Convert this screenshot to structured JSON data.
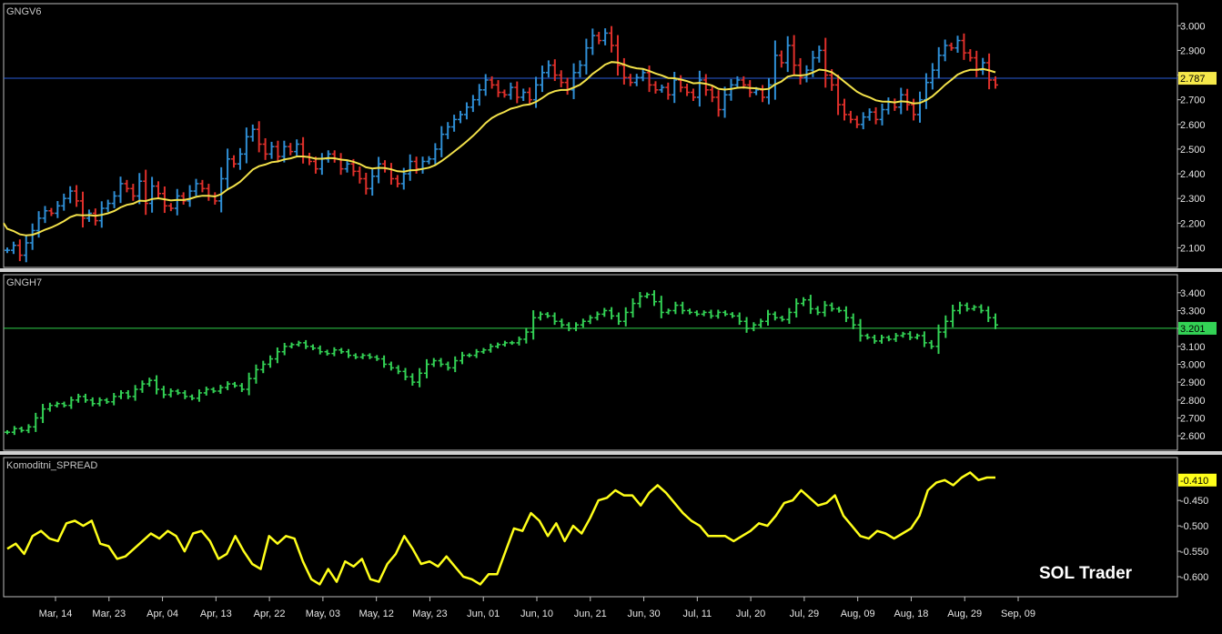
{
  "brand": "SOL Trader",
  "colors": {
    "up_bar": "#2f8fd6",
    "down_bar": "#e0302b",
    "ma_line": "#f2e14a",
    "green_bar": "#33d255",
    "spread_line": "#ffff1a",
    "price_line_1": "#2a5bd8",
    "price_line_2": "#2fd04a",
    "background": "#000000",
    "frame": "#c8c8c8"
  },
  "chart_data": [
    {
      "panel": "GNGV6",
      "type": "ohlc",
      "title": "GNGV6",
      "ylim": [
        2.05,
        3.06
      ],
      "yticks": [
        "3.000",
        "2.900",
        "2.800",
        "2.700",
        "2.600",
        "2.500",
        "2.400",
        "2.300",
        "2.200",
        "2.100"
      ],
      "last_label": "2.787",
      "last_value": 2.787,
      "ma_color": "ma_line",
      "closes": [
        2.09,
        2.11,
        2.07,
        2.12,
        2.17,
        2.22,
        2.25,
        2.24,
        2.27,
        2.3,
        2.33,
        2.29,
        2.22,
        2.24,
        2.21,
        2.26,
        2.28,
        2.31,
        2.36,
        2.34,
        2.31,
        2.37,
        2.28,
        2.35,
        2.32,
        2.27,
        2.26,
        2.31,
        2.29,
        2.33,
        2.36,
        2.34,
        2.31,
        2.29,
        2.38,
        2.46,
        2.44,
        2.48,
        2.55,
        2.58,
        2.52,
        2.48,
        2.51,
        2.47,
        2.51,
        2.49,
        2.52,
        2.47,
        2.45,
        2.42,
        2.46,
        2.48,
        2.46,
        2.42,
        2.44,
        2.41,
        2.38,
        2.34,
        2.39,
        2.44,
        2.42,
        2.38,
        2.36,
        2.4,
        2.45,
        2.42,
        2.45,
        2.46,
        2.5,
        2.56,
        2.59,
        2.62,
        2.64,
        2.67,
        2.7,
        2.74,
        2.78,
        2.76,
        2.73,
        2.72,
        2.75,
        2.71,
        2.73,
        2.7,
        2.76,
        2.81,
        2.84,
        2.8,
        2.77,
        2.74,
        2.81,
        2.84,
        2.91,
        2.96,
        2.94,
        2.97,
        2.92,
        2.84,
        2.79,
        2.77,
        2.79,
        2.81,
        2.76,
        2.74,
        2.75,
        2.72,
        2.78,
        2.75,
        2.73,
        2.71,
        2.78,
        2.74,
        2.71,
        2.66,
        2.72,
        2.76,
        2.78,
        2.76,
        2.73,
        2.74,
        2.71,
        2.76,
        2.88,
        2.85,
        2.92,
        2.84,
        2.79,
        2.82,
        2.87,
        2.9,
        2.8,
        2.76,
        2.68,
        2.64,
        2.62,
        2.6,
        2.63,
        2.65,
        2.62,
        2.66,
        2.69,
        2.67,
        2.72,
        2.68,
        2.64,
        2.7,
        2.77,
        2.82,
        2.88,
        2.92,
        2.91,
        2.94,
        2.89,
        2.87,
        2.82,
        2.85,
        2.78,
        2.76
      ]
    },
    {
      "panel": "GNGH7",
      "type": "ohlc",
      "title": "GNGH7",
      "ylim": [
        2.56,
        3.46
      ],
      "yticks": [
        "3.400",
        "3.300",
        "3.200",
        "3.100",
        "3.000",
        "2.900",
        "2.800",
        "2.700",
        "2.600"
      ],
      "last_label": "3.201",
      "last_value": 3.201,
      "closes": [
        2.62,
        2.64,
        2.63,
        2.65,
        2.7,
        2.75,
        2.77,
        2.78,
        2.77,
        2.8,
        2.82,
        2.8,
        2.78,
        2.8,
        2.79,
        2.82,
        2.84,
        2.82,
        2.86,
        2.89,
        2.91,
        2.86,
        2.83,
        2.85,
        2.84,
        2.82,
        2.81,
        2.84,
        2.86,
        2.85,
        2.87,
        2.89,
        2.88,
        2.86,
        2.92,
        2.97,
        3.0,
        3.03,
        3.07,
        3.1,
        3.11,
        3.12,
        3.1,
        3.09,
        3.07,
        3.06,
        3.08,
        3.07,
        3.05,
        3.04,
        3.05,
        3.04,
        3.03,
        3.0,
        2.98,
        2.96,
        2.93,
        2.9,
        2.95,
        3.0,
        3.02,
        3.0,
        2.98,
        3.02,
        3.05,
        3.05,
        3.07,
        3.08,
        3.1,
        3.11,
        3.12,
        3.12,
        3.14,
        3.18,
        3.26,
        3.28,
        3.27,
        3.24,
        3.22,
        3.2,
        3.22,
        3.24,
        3.26,
        3.28,
        3.3,
        3.27,
        3.24,
        3.29,
        3.34,
        3.38,
        3.39,
        3.35,
        3.29,
        3.3,
        3.33,
        3.3,
        3.29,
        3.28,
        3.29,
        3.27,
        3.29,
        3.28,
        3.27,
        3.24,
        3.2,
        3.22,
        3.24,
        3.28,
        3.26,
        3.25,
        3.29,
        3.34,
        3.36,
        3.31,
        3.29,
        3.33,
        3.31,
        3.3,
        3.26,
        3.22,
        3.16,
        3.15,
        3.13,
        3.15,
        3.14,
        3.16,
        3.17,
        3.15,
        3.16,
        3.12,
        3.1,
        3.18,
        3.24,
        3.3,
        3.33,
        3.31,
        3.32,
        3.3,
        3.26,
        3.22
      ]
    },
    {
      "panel": "Komoditni_SPREAD",
      "type": "line",
      "title": "Komoditni_SPREAD",
      "ylim": [
        -0.625,
        -0.38
      ],
      "yticks": [
        "-0.450",
        "-0.500",
        "-0.550",
        "-0.600"
      ],
      "last_label": "-0.410",
      "last_value": -0.41,
      "values": [
        -0.545,
        -0.535,
        -0.555,
        -0.52,
        -0.51,
        -0.525,
        -0.53,
        -0.495,
        -0.49,
        -0.5,
        -0.49,
        -0.535,
        -0.54,
        -0.565,
        -0.56,
        -0.545,
        -0.53,
        -0.515,
        -0.525,
        -0.51,
        -0.52,
        -0.55,
        -0.515,
        -0.51,
        -0.53,
        -0.565,
        -0.555,
        -0.52,
        -0.55,
        -0.575,
        -0.585,
        -0.52,
        -0.535,
        -0.52,
        -0.525,
        -0.57,
        -0.605,
        -0.615,
        -0.585,
        -0.61,
        -0.57,
        -0.58,
        -0.565,
        -0.605,
        -0.61,
        -0.575,
        -0.555,
        -0.52,
        -0.545,
        -0.575,
        -0.57,
        -0.58,
        -0.56,
        -0.58,
        -0.6,
        -0.605,
        -0.615,
        -0.595,
        -0.595,
        -0.55,
        -0.505,
        -0.51,
        -0.475,
        -0.49,
        -0.52,
        -0.495,
        -0.53,
        -0.5,
        -0.515,
        -0.485,
        -0.45,
        -0.445,
        -0.43,
        -0.44,
        -0.44,
        -0.46,
        -0.435,
        -0.42,
        -0.435,
        -0.455,
        -0.475,
        -0.49,
        -0.5,
        -0.52,
        -0.52,
        -0.52,
        -0.53,
        -0.52,
        -0.51,
        -0.495,
        -0.5,
        -0.48,
        -0.455,
        -0.45,
        -0.43,
        -0.445,
        -0.46,
        -0.455,
        -0.44,
        -0.48,
        -0.5,
        -0.52,
        -0.525,
        -0.51,
        -0.515,
        -0.525,
        -0.515,
        -0.505,
        -0.48,
        -0.43,
        -0.415,
        -0.41,
        -0.42,
        -0.405,
        -0.395,
        -0.41,
        -0.405,
        -0.405
      ]
    }
  ],
  "x_axis": {
    "labels": [
      "Mar, 14",
      "Mar, 23",
      "Apr, 04",
      "Apr, 13",
      "Apr, 22",
      "May, 03",
      "May, 12",
      "May, 23",
      "Jun, 01",
      "Jun, 10",
      "Jun, 21",
      "Jun, 30",
      "Jul, 11",
      "Jul, 20",
      "Jul, 29",
      "Aug, 09",
      "Aug, 18",
      "Aug, 29",
      "Sep, 09"
    ]
  }
}
